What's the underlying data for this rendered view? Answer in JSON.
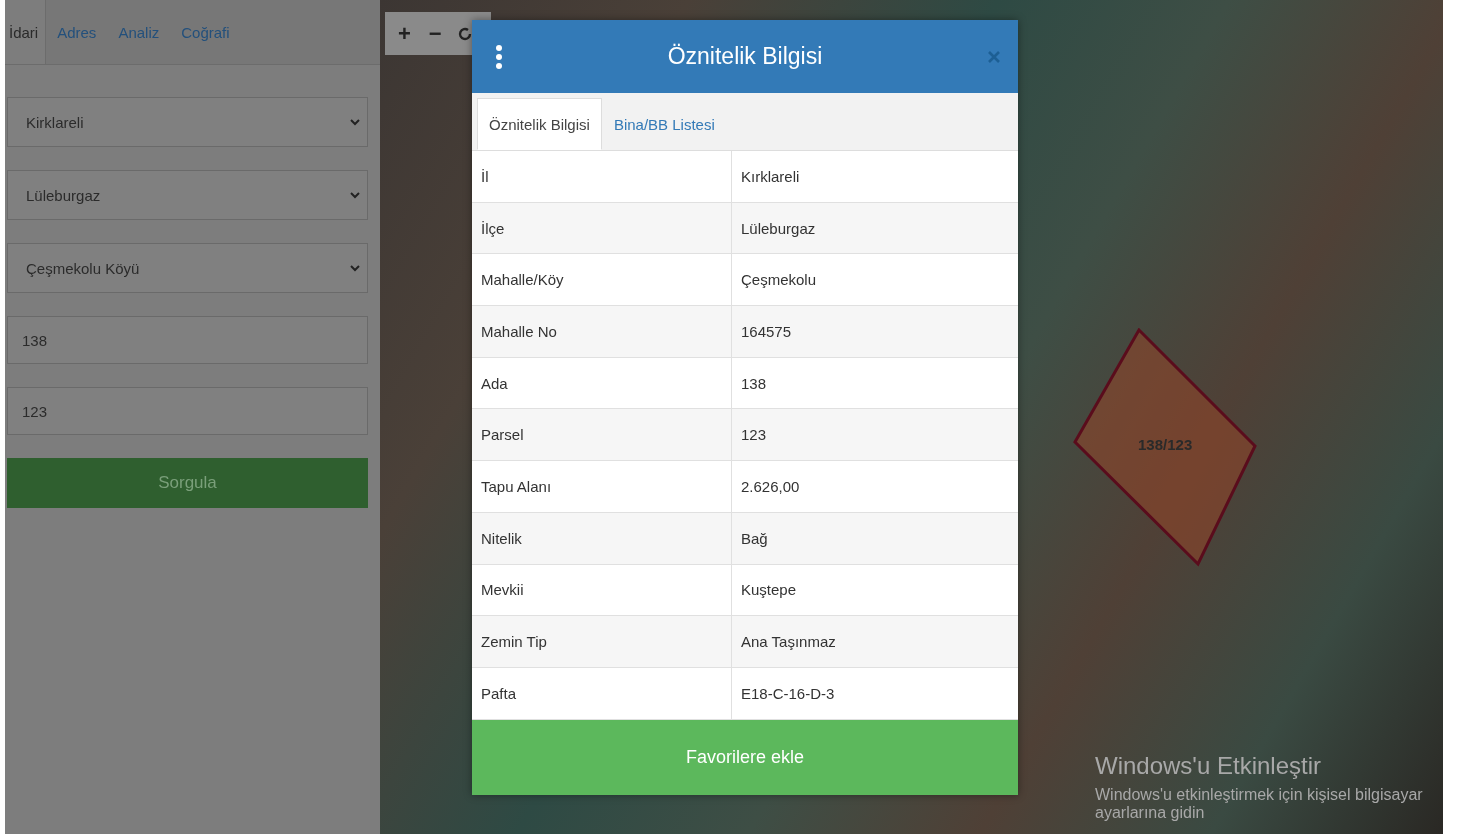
{
  "sidebar": {
    "tabs": [
      {
        "label": "İdari",
        "selected": true
      },
      {
        "label": "Adres",
        "selected": false
      },
      {
        "label": "Analiz",
        "selected": false
      },
      {
        "label": "Coğrafi",
        "selected": false
      }
    ],
    "selects": [
      {
        "value": "Kirklareli"
      },
      {
        "value": "Lüleburgaz"
      },
      {
        "value": "Çeşmekolu Köyü"
      }
    ],
    "inputs": [
      {
        "value": "138"
      },
      {
        "value": "123"
      }
    ],
    "button": "Sorgula"
  },
  "map": {
    "zoom_buttons": [
      "+",
      "−"
    ],
    "parcel_label": "138/123"
  },
  "modal": {
    "title": "Öznitelik Bilgisi",
    "tabs": [
      {
        "label": "Öznitelik Bilgisi",
        "selected": true
      },
      {
        "label": "Bina/BB Listesi",
        "selected": false
      }
    ],
    "rows": [
      {
        "label": "İl",
        "value": "Kırklareli"
      },
      {
        "label": "İlçe",
        "value": "Lüleburgaz"
      },
      {
        "label": "Mahalle/Köy",
        "value": "Çeşmekolu"
      },
      {
        "label": "Mahalle No",
        "value": "164575"
      },
      {
        "label": "Ada",
        "value": "138"
      },
      {
        "label": "Parsel",
        "value": "123"
      },
      {
        "label": "Tapu Alanı",
        "value": "2.626,00"
      },
      {
        "label": "Nitelik",
        "value": "Bağ"
      },
      {
        "label": "Mevkii",
        "value": "Kuştepe"
      },
      {
        "label": "Zemin Tip",
        "value": "Ana Taşınmaz"
      },
      {
        "label": "Pafta",
        "value": "E18-C-16-D-3"
      }
    ],
    "button": "Favorilere ekle"
  },
  "activation": {
    "title": "Windows'u Etkinleştir",
    "text": "Windows'u etkinleştirmek için kişisel bilgisayar ayarlarına gidin"
  }
}
